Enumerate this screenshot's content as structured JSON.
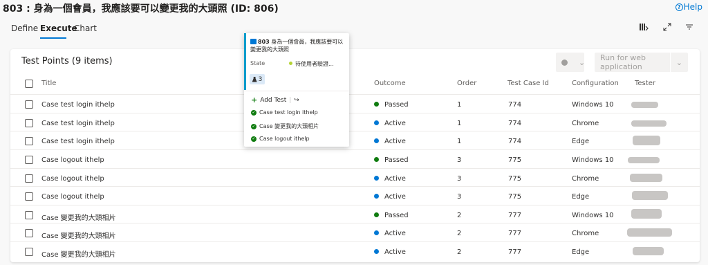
{
  "page": {
    "title": "803 : 身為一個會員，我應該要可以變更我的大頭照 (ID: 806)",
    "help": "Help"
  },
  "tabs": [
    {
      "label": "Define",
      "active": false
    },
    {
      "label": "Execute",
      "active": true
    },
    {
      "label": "Chart",
      "active": false
    }
  ],
  "card": {
    "title": "Test Points (9 items)",
    "run_button": "Run for web application"
  },
  "columns": {
    "title": "Title",
    "outcome": "Outcome",
    "order": "Order",
    "test_case_id": "Test Case Id",
    "configuration": "Configuration",
    "tester": "Tester"
  },
  "rows": [
    {
      "title": "Case test login ithelp",
      "outcome": "Passed",
      "order": "1",
      "id": "774",
      "config": "Windows 10"
    },
    {
      "title": "Case test login ithelp",
      "outcome": "Active",
      "order": "1",
      "id": "774",
      "config": "Chrome"
    },
    {
      "title": "Case test login ithelp",
      "outcome": "Active",
      "order": "1",
      "id": "774",
      "config": "Edge"
    },
    {
      "title": "Case logout ithelp",
      "outcome": "Passed",
      "order": "3",
      "id": "775",
      "config": "Windows 10"
    },
    {
      "title": "Case logout ithelp",
      "outcome": "Active",
      "order": "3",
      "id": "775",
      "config": "Chrome"
    },
    {
      "title": "Case logout ithelp",
      "outcome": "Active",
      "order": "3",
      "id": "775",
      "config": "Edge"
    },
    {
      "title": "Case 變更我的大頭相片",
      "outcome": "Passed",
      "order": "2",
      "id": "777",
      "config": "Windows 10"
    },
    {
      "title": "Case 變更我的大頭相片",
      "outcome": "Active",
      "order": "2",
      "id": "777",
      "config": "Chrome"
    },
    {
      "title": "Case 變更我的大頭相片",
      "outcome": "Active",
      "order": "2",
      "id": "777",
      "config": "Edge"
    }
  ],
  "popup": {
    "id": "803",
    "title": "身為一個會員，我應該要可以變更我的大頭照",
    "state_label": "State",
    "state_value": "待使用者驗證...",
    "test_count": "3",
    "add_test": "Add Test",
    "items": [
      "Case test login ithelp",
      "Case 變更我的大頭相片",
      "Case logout ithelp"
    ]
  },
  "colors": {
    "passed": "#107c10",
    "active": "#0078d4",
    "accent": "#009ccc"
  }
}
